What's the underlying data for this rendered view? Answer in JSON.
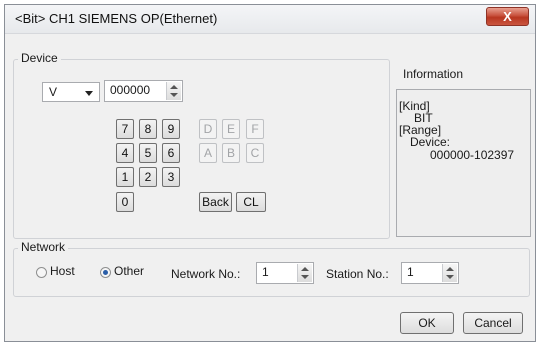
{
  "window": {
    "title": "<Bit> CH1 SIEMENS OP(Ethernet)",
    "close_label": "X"
  },
  "device": {
    "group_label": "Device",
    "type_value": "V",
    "address_value": "000000",
    "keypad": {
      "digits": [
        "7",
        "8",
        "9",
        "4",
        "5",
        "6",
        "1",
        "2",
        "3",
        "0"
      ],
      "hex": [
        "D",
        "E",
        "F",
        "A",
        "B",
        "C"
      ],
      "back_label": "Back",
      "clear_label": "CL"
    }
  },
  "information": {
    "title": "Information",
    "kind_heading": "[Kind]",
    "kind_value": "BIT",
    "range_heading": "[Range]",
    "range_device_label": "Device:",
    "range_value": "000000-102397"
  },
  "network": {
    "group_label": "Network",
    "host_label": "Host",
    "other_label": "Other",
    "selected": "Other",
    "network_no_label": "Network No.:",
    "network_no_value": "1",
    "station_no_label": "Station No.:",
    "station_no_value": "1"
  },
  "buttons": {
    "ok": "OK",
    "cancel": "Cancel"
  }
}
